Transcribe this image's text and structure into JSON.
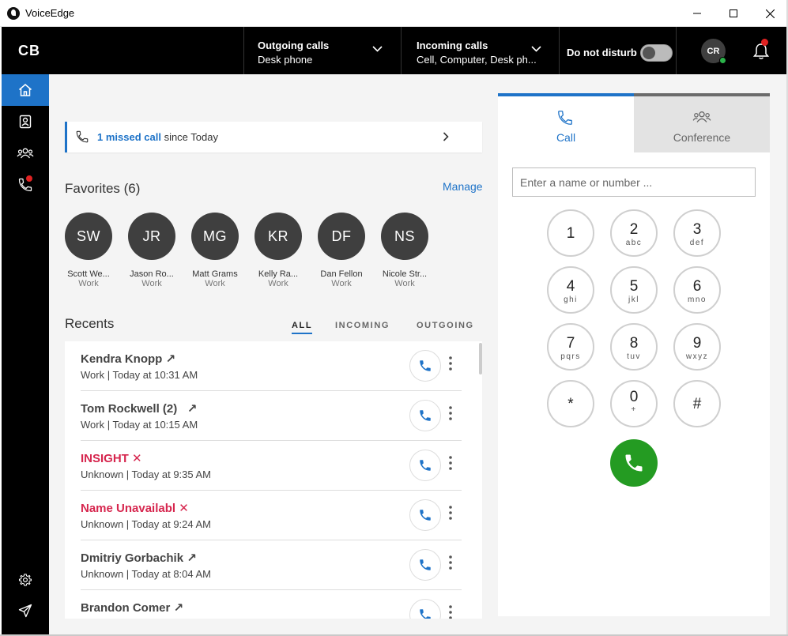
{
  "window": {
    "title": "VoiceEdge"
  },
  "header": {
    "brand": "CB",
    "outgoing": {
      "label": "Outgoing calls",
      "value": "Desk phone"
    },
    "incoming": {
      "label": "Incoming calls",
      "value": "Cell, Computer, Desk ph..."
    },
    "dnd_label": "Do not disturb",
    "dnd_on": false,
    "avatar_initials": "CR"
  },
  "missed_banner": {
    "link": "1 missed call",
    "text": " since Today"
  },
  "favorites": {
    "title": "Favorites (6)",
    "manage": "Manage",
    "items": [
      {
        "initials": "SW",
        "name": "Scott We...",
        "type": "Work"
      },
      {
        "initials": "JR",
        "name": "Jason Ro...",
        "type": "Work"
      },
      {
        "initials": "MG",
        "name": "Matt Grams",
        "type": "Work"
      },
      {
        "initials": "KR",
        "name": "Kelly Ra...",
        "type": "Work"
      },
      {
        "initials": "DF",
        "name": "Dan Fellon",
        "type": "Work"
      },
      {
        "initials": "NS",
        "name": "Nicole Str...",
        "type": "Work"
      }
    ]
  },
  "recents": {
    "title": "Recents",
    "tabs": [
      "ALL",
      "INCOMING",
      "OUTGOING"
    ],
    "items": [
      {
        "name": "Kendra Knopp",
        "marker": "↗",
        "meta": "Work |  Today at 10:31 AM",
        "missed": false
      },
      {
        "name": "Tom Rockwell (2)",
        "marker": "↗",
        "meta": "Work |  Today at 10:15 AM",
        "missed": false
      },
      {
        "name": "INSIGHT",
        "marker": "✕",
        "meta": "Unknown |  Today at 9:35 AM",
        "missed": true
      },
      {
        "name": "Name Unavailabl",
        "marker": "✕",
        "meta": "Unknown |  Today at 9:24 AM",
        "missed": true
      },
      {
        "name": "Dmitriy Gorbachik",
        "marker": "↗",
        "meta": "Unknown |  Today at 8:04 AM",
        "missed": false
      },
      {
        "name": "Brandon Comer",
        "marker": "↗",
        "meta": "",
        "missed": false
      }
    ]
  },
  "dialer": {
    "tabs": {
      "call": "Call",
      "conference": "Conference"
    },
    "placeholder": "Enter a name or number ...",
    "keys": [
      {
        "digit": "1",
        "letters": ""
      },
      {
        "digit": "2",
        "letters": "abc"
      },
      {
        "digit": "3",
        "letters": "def"
      },
      {
        "digit": "4",
        "letters": "ghi"
      },
      {
        "digit": "5",
        "letters": "jkl"
      },
      {
        "digit": "6",
        "letters": "mno"
      },
      {
        "digit": "7",
        "letters": "pqrs"
      },
      {
        "digit": "8",
        "letters": "tuv"
      },
      {
        "digit": "9",
        "letters": "wxyz"
      },
      {
        "digit": "*",
        "letters": ""
      },
      {
        "digit": "0",
        "letters": "+"
      },
      {
        "digit": "#",
        "letters": ""
      }
    ]
  },
  "colors": {
    "accent": "#1e73c8",
    "missed": "#d6264e",
    "call_green": "#249b22",
    "header_bg": "#000000"
  }
}
